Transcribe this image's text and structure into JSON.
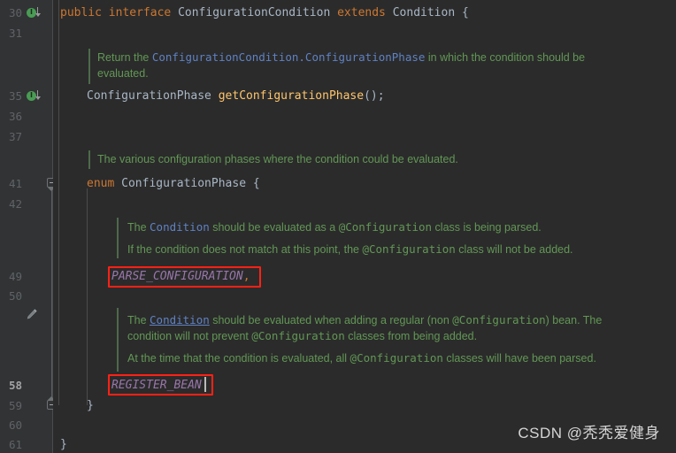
{
  "editor": {
    "theme_name": "darcula",
    "background": "#2B2B2B",
    "gutter_background": "#313335",
    "accent_highlight": "#FF2116",
    "current_line": "58",
    "line_numbers": [
      "30",
      "31",
      "35",
      "36",
      "37",
      "41",
      "42",
      "49",
      "50",
      "58",
      "59",
      "60",
      "61"
    ],
    "gutter_icons": [
      {
        "name": "implemented-method-marker",
        "label": "I",
        "line": "30"
      },
      {
        "name": "implemented-method-marker",
        "label": "I",
        "line": "35"
      },
      {
        "name": "edit-pencil-marker",
        "label": "",
        "line": ""
      }
    ],
    "fold_markers": [
      {
        "name": "fold-collapse-enum",
        "line": "41",
        "state": "expanded"
      },
      {
        "name": "fold-collapse-end",
        "line": "59",
        "state": "expanded"
      }
    ]
  },
  "code": {
    "line_30": {
      "kw_public": "public",
      "kw_interface": "interface",
      "type_name": "ConfigurationCondition",
      "kw_extends": "extends",
      "super_name": "Condition",
      "brace": "{"
    },
    "doc_1": {
      "text_a": "Return the ",
      "link": "ConfigurationCondition.ConfigurationPhase",
      "text_b": " in which the condition should be",
      "line2": "evaluated."
    },
    "line_35": {
      "return_type": "ConfigurationPhase",
      "method_name": "getConfigurationPhase",
      "tail": "();"
    },
    "doc_2": {
      "text": "The various configuration phases where the condition could be evaluated."
    },
    "line_41": {
      "kw_enum": "enum",
      "enum_name": "ConfigurationPhase",
      "brace": "{"
    },
    "doc_3": {
      "l1_a": "The ",
      "l1_link": "Condition",
      "l1_b": " should be evaluated as a ",
      "l1_mono": "@Configuration",
      "l1_c": " class is being parsed.",
      "l2_a": "If the condition does not match at this point, the ",
      "l2_mono": "@Configuration",
      "l2_b": " class will not be added."
    },
    "line_49": {
      "constant": "PARSE_CONFIGURATION",
      "comma": ","
    },
    "doc_4": {
      "l1_a": "The ",
      "l1_link": "Condition",
      "l1_b": " should be evaluated when adding a regular (non ",
      "l1_mono": "@Configuration",
      "l1_c": ") bean. The",
      "l2_a": "condition will not prevent ",
      "l2_mono": "@Configuration",
      "l2_b": " classes from being added.",
      "l3_a": "At the time that the condition is evaluated, all ",
      "l3_mono": "@Configuration",
      "l3_b": " classes will have been parsed."
    },
    "line_58": {
      "constant": "REGISTER_BEAN"
    },
    "line_59": {
      "brace": "}"
    },
    "line_61": {
      "brace": "}"
    }
  },
  "highlights": [
    {
      "name": "red-box-parse-configuration",
      "target": "PARSE_CONFIGURATION,"
    },
    {
      "name": "red-box-register-bean",
      "target": "REGISTER_BEAN"
    }
  ],
  "watermark": {
    "text": "CSDN @秃秃爱健身"
  }
}
